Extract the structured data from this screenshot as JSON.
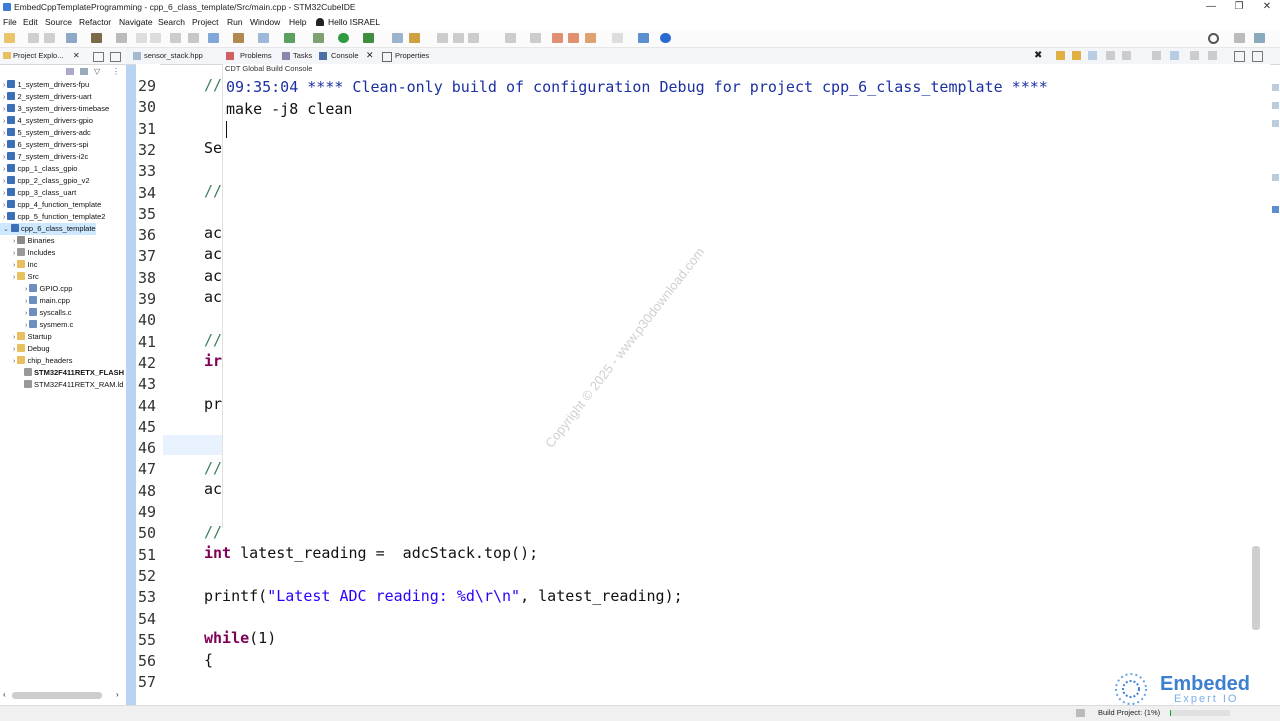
{
  "window": {
    "title": "EmbedCppTemplateProgramming - cpp_6_class_template/Src/main.cpp - STM32CubeIDE",
    "minimize": "—",
    "maximize": "❐",
    "close": "✕"
  },
  "menubar": {
    "items": [
      "File",
      "Edit",
      "Source",
      "Refactor",
      "Navigate",
      "Search",
      "Project",
      "Run",
      "Window",
      "Help"
    ],
    "user": "Hello ISRAEL"
  },
  "explorer": {
    "tab_label": "Project Explo...",
    "projects": [
      "1_system_drivers-fpu",
      "2_system_drivers-uart",
      "3_system_drivers-timebase",
      "4_system_drivers-gpio",
      "5_system_drivers-adc",
      "6_system_drivers-spi",
      "7_system_drivers-i2c",
      "cpp_1_class_gpio",
      "cpp_2_class_gpio_v2",
      "cpp_3_class_uart",
      "cpp_4_function_template",
      "cpp_5_function_template2",
      "cpp_6_class_template"
    ],
    "children": [
      "Binaries",
      "Includes",
      "Inc",
      "Src"
    ],
    "src_files": [
      "GPIO.cpp",
      "main.cpp",
      "syscalls.c",
      "sysmem.c"
    ],
    "folders": [
      "Startup",
      "Debug",
      "chip_headers"
    ],
    "ld_files": [
      "STM32F411RETX_FLASH",
      "STM32F411RETX_RAM.ld"
    ]
  },
  "tabs": {
    "editor_file": "sensor_stack.hpp",
    "problems": "Problems",
    "tasks": "Tasks",
    "console": "Console",
    "properties": "Properties"
  },
  "console": {
    "title": "CDT Global Build Console",
    "line1": "09:35:04 **** Clean-only build of configuration Debug for project cpp_6_class_template ****",
    "line2": "make -j8 clean"
  },
  "editor": {
    "line_numbers": [
      "29",
      "30",
      "31",
      "32",
      "33",
      "34",
      "35",
      "36",
      "37",
      "38",
      "39",
      "40",
      "41",
      "42",
      "43",
      "44",
      "45",
      "46",
      "47",
      "48",
      "49",
      "50",
      "51",
      "52",
      "53",
      "54",
      "55",
      "56",
      "57"
    ],
    "visible_prefix": {
      "l29": "//",
      "l30": "//",
      "l32": "Se",
      "l34": "//",
      "l36": "ac",
      "l37": "ac",
      "l38": "ac",
      "l39": "ac",
      "l41": "//",
      "l42": "ir",
      "l44": "pr",
      "l47": "//",
      "l48": "ac",
      "l50": "//"
    },
    "l51_kw": "int",
    "l51_rest": " latest_reading =  adcStack.top();",
    "l53_fn": "printf(",
    "l53_str": "\"Latest ADC reading: %d\\r\\n\"",
    "l53_rest": ", latest_reading);",
    "l55_kw": "while",
    "l55_rest": "(1)",
    "l56": "{"
  },
  "watermark": "Copyright © 2025 - www.p30download.com",
  "logo": {
    "line1": "Embeded",
    "line2": "Expert IO"
  },
  "status": {
    "build": "Build Project: (1%)"
  },
  "colors": {
    "splitter": "#b9d4f2",
    "console_text": "#1c2fa3",
    "selection": "#cde8ff",
    "keyword": "#7f0055"
  }
}
